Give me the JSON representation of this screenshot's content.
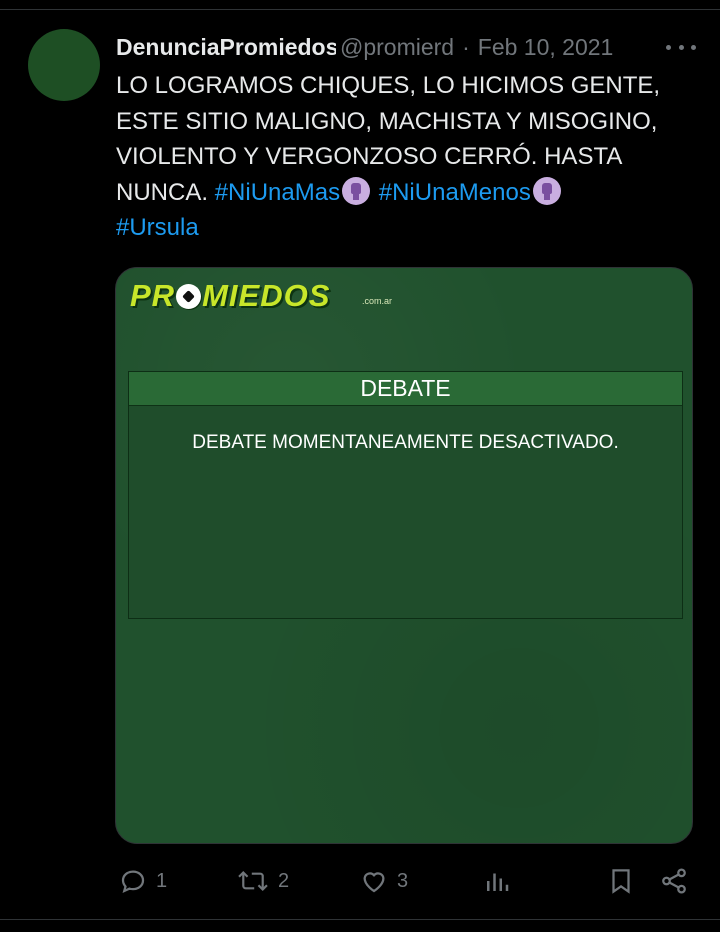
{
  "tweet": {
    "display_name": "DenunciaPromiedos",
    "handle": "@promierd",
    "separator": "·",
    "date": "Feb 10, 2021",
    "text_lines": [
      "LO LOGRAMOS CHIQUES, LO HICIMOS GENTE,",
      "ESTE SITIO MALIGNO, MACHISTA Y MISOGINO,",
      "VIOLENTO Y VERGONZOSO CERRÓ. HASTA",
      "NUNCA."
    ],
    "hashtags": [
      "#NiUnaMas",
      "#NiUnaMenos",
      "#Ursula"
    ],
    "emoji": "raised-fist-icon"
  },
  "media": {
    "logo_text": "PROMIEDOS",
    "logo_suffix": ".com.ar",
    "debate_title": "DEBATE",
    "debate_message": "DEBATE MOMENTANEAMENTE DESACTIVADO."
  },
  "actions": {
    "replies": "1",
    "retweets": "2",
    "likes": "3"
  },
  "colors": {
    "background": "#000000",
    "text": "#e7e9ea",
    "muted": "#71767b",
    "link": "#1d9bf0",
    "card_green": "#20512d"
  }
}
